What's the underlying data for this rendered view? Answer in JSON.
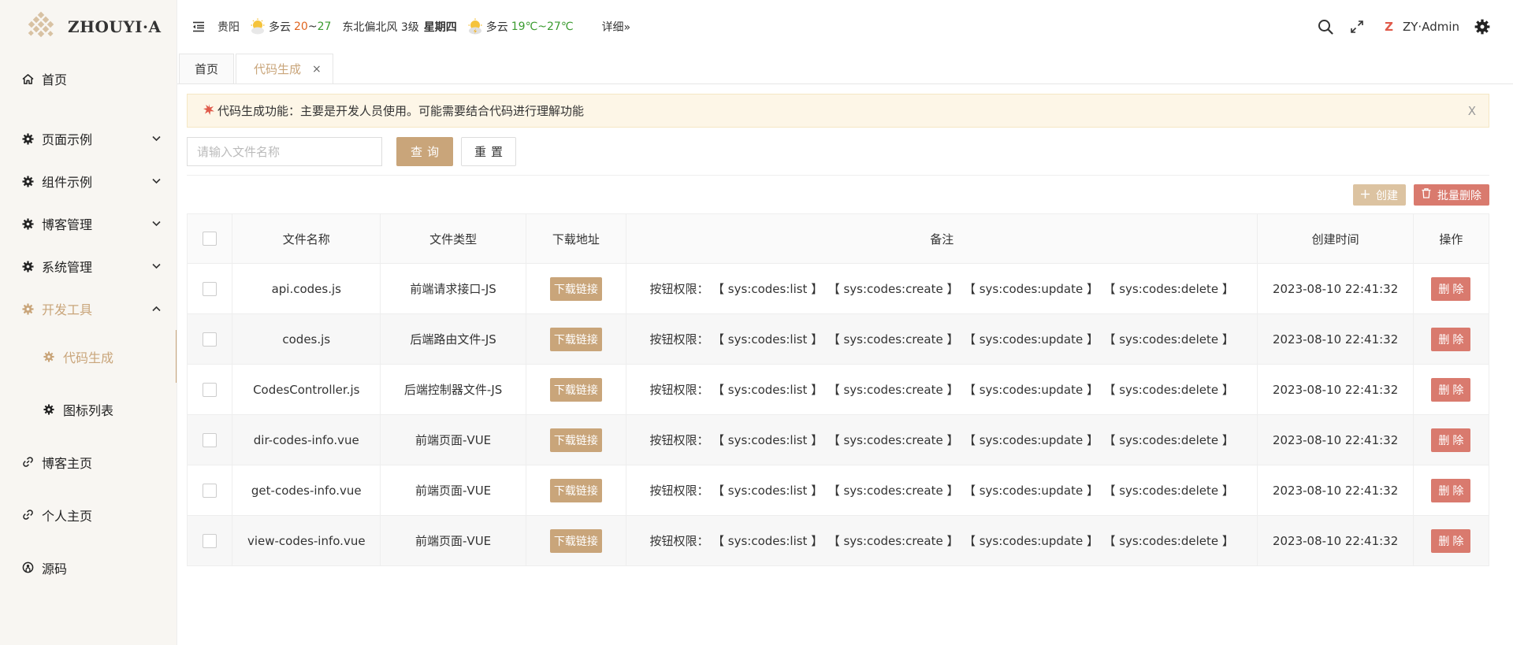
{
  "app": {
    "logo_text": "ZHOUYI·A",
    "colors": {
      "accent": "#c9a57a",
      "danger": "#d97a6e",
      "notice_bg": "#fdf6e7"
    }
  },
  "sidebar": {
    "items": [
      {
        "label": "首页",
        "icon": "home-icon"
      },
      {
        "label": "页面示例",
        "icon": "gear-icon",
        "arrow": "chevron-down"
      },
      {
        "label": "组件示例",
        "icon": "gear-icon",
        "arrow": "chevron-down"
      },
      {
        "label": "博客管理",
        "icon": "gear-icon",
        "arrow": "chevron-down"
      },
      {
        "label": "系统管理",
        "icon": "gear-icon",
        "arrow": "chevron-down"
      },
      {
        "label": "开发工具",
        "icon": "gear-icon",
        "arrow": "chevron-up",
        "expanded": true
      },
      {
        "label": "博客主页",
        "icon": "link-icon"
      },
      {
        "label": "个人主页",
        "icon": "link-icon"
      },
      {
        "label": "源码",
        "icon": "github-icon"
      }
    ],
    "subitems": [
      {
        "label": "代码生成",
        "icon": "gear-icon",
        "active": true
      },
      {
        "label": "图标列表",
        "icon": "gear-icon"
      }
    ]
  },
  "header": {
    "weather": {
      "city": "贵阳",
      "today_cond": "多云",
      "today_hi": "20",
      "today_tilde": "~",
      "today_lo": "27",
      "wind": "东北偏北风 3级",
      "weekday": "星期四",
      "tomorrow_cond": "多云",
      "tomorrow_temp": "19℃~27℃",
      "detail": "详细»"
    },
    "user": {
      "mark": "Z",
      "name": "ZY·Admin"
    }
  },
  "tabs": [
    {
      "label": "首页"
    },
    {
      "label": "代码生成",
      "active": true,
      "close": "×"
    }
  ],
  "notice": {
    "text": "代码生成功能：主要是开发人员使用。可能需要结合代码进行理解功能",
    "close": "X"
  },
  "search": {
    "placeholder": "请输入文件名称",
    "query_label": "查询",
    "reset_label": "重置"
  },
  "toolbar": {
    "create_label": "创建",
    "batch_delete_label": "批量删除"
  },
  "table": {
    "columns": [
      "文件名称",
      "文件类型",
      "下载地址",
      "备注",
      "创建时间",
      "操作"
    ],
    "download_label": "下载链接",
    "delete_label": "删除",
    "perm_prefix": "按钮权限：",
    "permissions": [
      "【 sys:codes:list 】",
      "【 sys:codes:create 】",
      "【 sys:codes:update 】",
      "【 sys:codes:delete 】"
    ],
    "rows": [
      {
        "name": "api.codes.js",
        "type": "前端请求接口-JS",
        "created": "2023-08-10 22:41:32"
      },
      {
        "name": "codes.js",
        "type": "后端路由文件-JS",
        "created": "2023-08-10 22:41:32"
      },
      {
        "name": "CodesController.js",
        "type": "后端控制器文件-JS",
        "created": "2023-08-10 22:41:32"
      },
      {
        "name": "dir-codes-info.vue",
        "type": "前端页面-VUE",
        "created": "2023-08-10 22:41:32"
      },
      {
        "name": "get-codes-info.vue",
        "type": "前端页面-VUE",
        "created": "2023-08-10 22:41:32"
      },
      {
        "name": "view-codes-info.vue",
        "type": "前端页面-VUE",
        "created": "2023-08-10 22:41:32"
      }
    ]
  }
}
